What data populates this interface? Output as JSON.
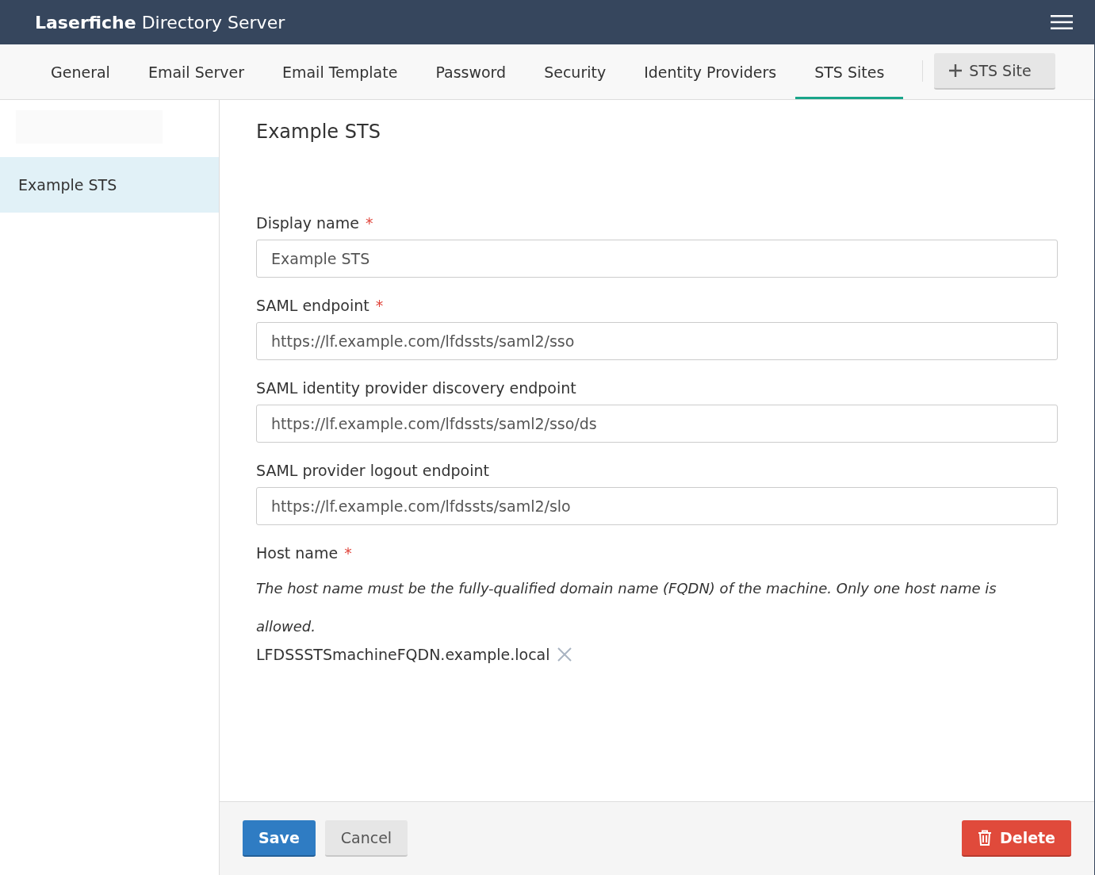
{
  "header": {
    "title_bold": "Laserfiche",
    "title_rest": "Directory Server"
  },
  "tabs": [
    {
      "label": "General",
      "selected": false
    },
    {
      "label": "Email Server",
      "selected": false
    },
    {
      "label": "Email Template",
      "selected": false
    },
    {
      "label": "Password",
      "selected": false
    },
    {
      "label": "Security",
      "selected": false
    },
    {
      "label": "Identity Providers",
      "selected": false
    },
    {
      "label": "STS Sites",
      "selected": true
    }
  ],
  "add_button": {
    "label": "STS Site"
  },
  "sidebar": {
    "items": [
      {
        "label": "Example STS",
        "selected": true
      }
    ]
  },
  "form": {
    "title": "Example STS",
    "fields": [
      {
        "label": "Display name",
        "required_mark": "*",
        "value": "Example STS"
      },
      {
        "label": "SAML endpoint",
        "required_mark": "*",
        "value": "https://lf.example.com/lfdssts/saml2/sso"
      },
      {
        "label": "SAML identity provider discovery endpoint",
        "value": "https://lf.example.com/lfdssts/saml2/sso/ds"
      },
      {
        "label": "SAML provider logout endpoint",
        "value": "https://lf.example.com/lfdssts/saml2/slo"
      }
    ],
    "host": {
      "label": "Host name",
      "required_mark": "*",
      "hint": "The host name must be the fully-qualified domain name (FQDN) of the machine. Only one host name is allowed.",
      "hosts": [
        "LFDSSSTSmachineFQDN.example.local"
      ]
    }
  },
  "footer": {
    "save": "Save",
    "cancel": "Cancel",
    "delete": "Delete"
  }
}
